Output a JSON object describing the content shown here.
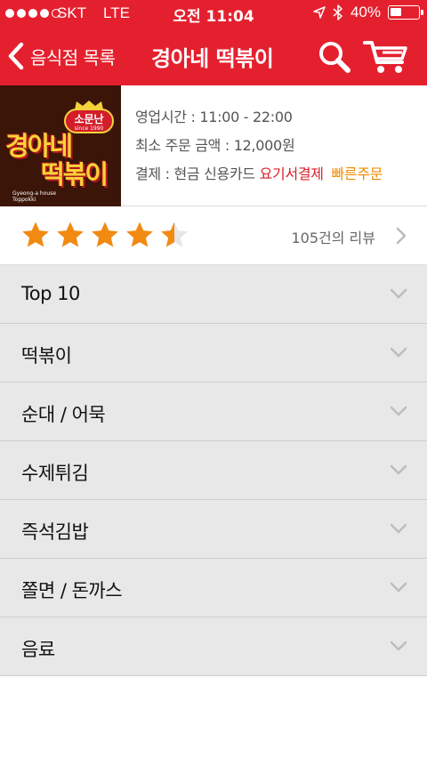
{
  "status_bar": {
    "carrier": "SKT",
    "network": "LTE",
    "time": "오전 11:04",
    "battery_text": "40%",
    "battery_level": 0.4,
    "icons": [
      "signal-dots",
      "location-arrow-icon",
      "bluetooth-icon",
      "battery-icon"
    ]
  },
  "nav": {
    "back_label": "음식점 목록",
    "title": "경아네 떡볶이",
    "icons": [
      "back-chevron-icon",
      "search-icon",
      "cart-icon"
    ]
  },
  "restaurant": {
    "logo": {
      "badge": "소문난",
      "since": "since 1990",
      "name_line1": "경아네",
      "name_line2": "떡볶이",
      "sub_line1": "Gyeong-a house",
      "sub_line2": "Toppokki"
    },
    "hours": "영업시간 : 11:00 - 22:00",
    "min_order": "최소 주문 금액 : 12,000원",
    "payment_label": "결제 : 현금 신용카드",
    "payment_yogiyo": "요기서결제",
    "payment_quick": "빠른주문"
  },
  "rating": {
    "stars": 4.5,
    "max_stars": 5,
    "review_text": "105건의 리뷰"
  },
  "categories": [
    {
      "label": "Top 10"
    },
    {
      "label": "떡볶이"
    },
    {
      "label": "순대 / 어묵"
    },
    {
      "label": "수제튀김"
    },
    {
      "label": "즉석김밥"
    },
    {
      "label": "쫄면 / 돈까스"
    },
    {
      "label": "음료"
    }
  ],
  "colors": {
    "brand_red": "#e5202e",
    "star_orange": "#f28a12",
    "yogiyo_red": "#d8202a",
    "quick_orange": "#f08a00",
    "category_bg": "#e8e8e8"
  }
}
